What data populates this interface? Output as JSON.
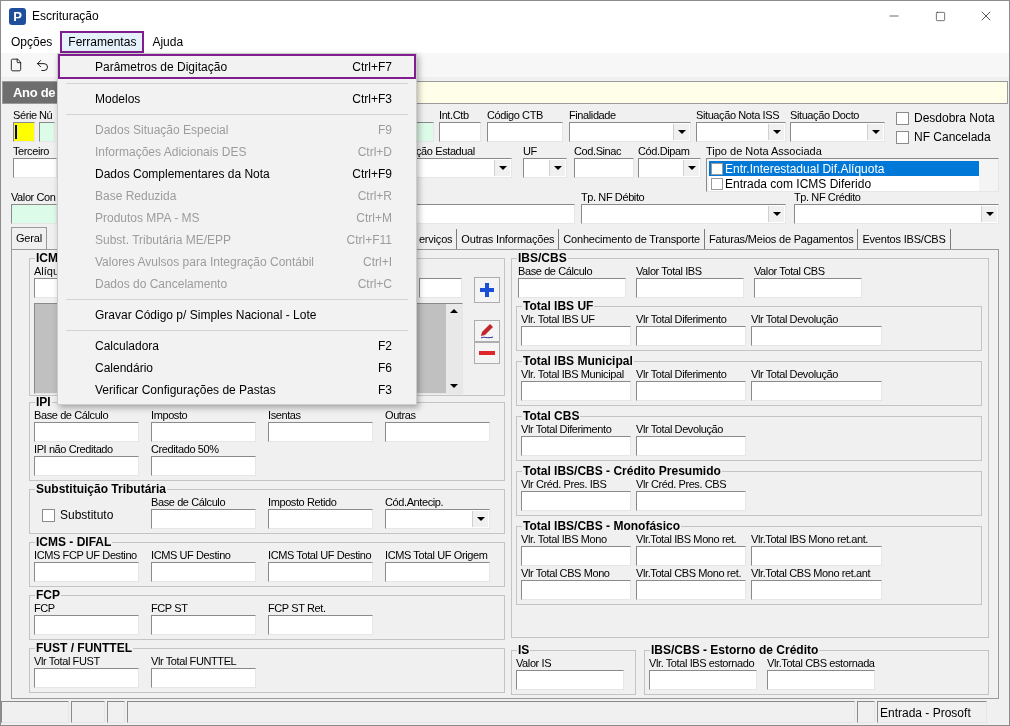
{
  "window": {
    "title": "Escrituração",
    "icon_letter": "P"
  },
  "menu_bar": [
    {
      "label": "Opções",
      "selected": false
    },
    {
      "label": "Ferramentas",
      "selected": true
    },
    {
      "label": "Ajuda",
      "selected": false
    }
  ],
  "menu": [
    {
      "kind": "item",
      "label": "Parâmetros de Digitação",
      "shortcut": "Ctrl+F7",
      "disabled": false,
      "selected": true
    },
    {
      "kind": "separator"
    },
    {
      "kind": "item",
      "label": "Modelos",
      "shortcut": "Ctrl+F3",
      "disabled": false,
      "selected": false
    },
    {
      "kind": "separator"
    },
    {
      "kind": "item",
      "label": "Dados Situação Especial",
      "shortcut": "F9",
      "disabled": true,
      "selected": false
    },
    {
      "kind": "item",
      "label": "Informações Adicionais DES",
      "shortcut": "Ctrl+D",
      "disabled": true,
      "selected": false
    },
    {
      "kind": "item",
      "label": "Dados Complementares da Nota",
      "shortcut": "Ctrl+F9",
      "disabled": false,
      "selected": false
    },
    {
      "kind": "item",
      "label": "Base Reduzida",
      "shortcut": "Ctrl+R",
      "disabled": true,
      "selected": false
    },
    {
      "kind": "item",
      "label": "Produtos MPA - MS",
      "shortcut": "Ctrl+M",
      "disabled": true,
      "selected": false
    },
    {
      "kind": "item",
      "label": "Subst. Tributária ME/EPP",
      "shortcut": "Ctrl+F11",
      "disabled": true,
      "selected": false
    },
    {
      "kind": "item",
      "label": "Valores Avulsos para Integração Contábil",
      "shortcut": "Ctrl+I",
      "disabled": true,
      "selected": false
    },
    {
      "kind": "item",
      "label": "Dados do Cancelamento",
      "shortcut": "Ctrl+C",
      "disabled": true,
      "selected": false
    },
    {
      "kind": "separator"
    },
    {
      "kind": "item",
      "label": "Gravar Código p/ Simples Nacional - Lote",
      "disabled": false,
      "selected": false
    },
    {
      "kind": "separator"
    },
    {
      "kind": "item",
      "label": "Calculadora",
      "shortcut": "F2",
      "disabled": false,
      "selected": false
    },
    {
      "kind": "item",
      "label": "Calendário",
      "shortcut": "F6",
      "disabled": false,
      "selected": false
    },
    {
      "kind": "item",
      "label": "Verificar Configurações de Pastas",
      "shortcut": "F3",
      "disabled": false,
      "selected": false
    }
  ],
  "band": {
    "title": "Ano de"
  },
  "header_row_1": [
    {
      "label": "Série",
      "kind": "focused"
    },
    {
      "label": "Nú",
      "kind": "key"
    },
    {
      "kind": "key"
    },
    {
      "label": "Int.Ctb",
      "kind": "text"
    },
    {
      "label": "Código CTB",
      "kind": "text"
    },
    {
      "label": "Finalidade",
      "kind": "combo"
    },
    {
      "label": "Situação Nota ISS",
      "kind": "combo"
    },
    {
      "label": "Situação Docto",
      "kind": "combo"
    }
  ],
  "header_checks": [
    {
      "label": "Desdobra Nota",
      "checked": false
    },
    {
      "label": "NF Cancelada",
      "checked": false
    }
  ],
  "header_row_2": [
    {
      "label": "Terceiro",
      "kind": "text"
    },
    {
      "label": "ção Estadual",
      "kind": "combo"
    },
    {
      "label": "UF",
      "kind": "combo"
    },
    {
      "label": "Cod.Sinac",
      "kind": "text"
    },
    {
      "label": "Cód.Dipam",
      "kind": "combo"
    }
  ],
  "nota_associada": {
    "label": "Tipo de Nota Associada",
    "items": [
      {
        "label": "Entr.Interestadual Dif.Alíquota",
        "checked": false,
        "selected": true
      },
      {
        "label": "Entrada com ICMS Diferido",
        "checked": false,
        "selected": false
      }
    ]
  },
  "header_row_3": [
    {
      "label": "Valor Con",
      "kind": "key"
    },
    {
      "kind": "text"
    },
    {
      "label": "Tp. NF Débito",
      "kind": "combo"
    },
    {
      "label": "Tp. NF Crédito",
      "kind": "combo"
    }
  ],
  "tabs": [
    {
      "label": "Geral",
      "selected": true
    },
    {
      "label": "erviços",
      "selected": false
    },
    {
      "label": "Outras Informações",
      "selected": false
    },
    {
      "label": "Conhecimento de Transporte",
      "selected": false
    },
    {
      "label": "Faturas/Meios de Pagamentos",
      "selected": false
    },
    {
      "label": "Eventos IBS/CBS",
      "selected": false
    }
  ],
  "icms": {
    "title": "ICM",
    "label": "Alíqu"
  },
  "ipi": {
    "title": "IPI",
    "rows": [
      [
        {
          "label": "Base de Cálculo",
          "kind": "text"
        },
        {
          "label": "Imposto",
          "kind": "text"
        },
        {
          "label": "Isentas",
          "kind": "text"
        },
        {
          "label": "Outras",
          "kind": "text"
        }
      ],
      [
        {
          "label": "IPI não Creditado",
          "kind": "text"
        },
        {
          "label": "Creditado 50%",
          "kind": "text"
        }
      ]
    ]
  },
  "st": {
    "title": "Substituição Tributária",
    "checkbox": {
      "label": "Substituto",
      "checked": false
    },
    "fields": [
      {
        "label": "Base de Cálculo",
        "kind": "text"
      },
      {
        "label": "Imposto Retido",
        "kind": "text"
      },
      {
        "label": "Cód.Antecip.",
        "kind": "combo"
      }
    ]
  },
  "left_groups": [
    {
      "title": "ICMS - DIFAL",
      "rows": [
        [
          {
            "label": "ICMS FCP UF Destino",
            "kind": "text"
          },
          {
            "label": "ICMS UF Destino",
            "kind": "text"
          },
          {
            "label": "ICMS Total UF Destino",
            "kind": "text"
          },
          {
            "label": "ICMS Total UF Origem",
            "kind": "text"
          }
        ]
      ]
    },
    {
      "title": "FCP",
      "rows": [
        [
          {
            "label": "FCP",
            "kind": "text"
          },
          {
            "label": "FCP ST",
            "kind": "text"
          },
          {
            "label": "FCP ST Ret.",
            "kind": "text"
          }
        ]
      ]
    },
    {
      "title": "FUST / FUNTTEL",
      "rows": [
        [
          {
            "label": "Vlr Total FUST",
            "kind": "text"
          },
          {
            "label": "Vlr Total FUNTTEL",
            "kind": "text"
          }
        ]
      ]
    }
  ],
  "ibs_cbs": {
    "title": "IBS/CBS",
    "fields": [
      {
        "label": "Base de Cálculo",
        "kind": "text"
      },
      {
        "label": "Valor Total IBS",
        "kind": "text"
      },
      {
        "label": "Valor Total CBS",
        "kind": "text"
      }
    ],
    "subgroups": [
      {
        "title": "Total IBS UF",
        "rows": [
          [
            {
              "label": "Vlr. Total IBS UF",
              "kind": "text"
            },
            {
              "label": "Vlr Total Diferimento",
              "kind": "text"
            },
            {
              "label": "Vlr Total Devolução",
              "kind": "text"
            }
          ]
        ]
      },
      {
        "title": "Total IBS Municipal",
        "rows": [
          [
            {
              "label": "Vlr. Total IBS Municipal",
              "kind": "text"
            },
            {
              "label": "Vlr Total Diferimento",
              "kind": "text"
            },
            {
              "label": "Vlr Total Devolução",
              "kind": "text"
            }
          ]
        ]
      },
      {
        "title": "Total CBS",
        "rows": [
          [
            {
              "label": "Vlr Total Diferimento",
              "kind": "text"
            },
            {
              "label": "Vlr Total Devolução",
              "kind": "text"
            }
          ]
        ]
      },
      {
        "title": "Total IBS/CBS - Crédito Presumido",
        "rows": [
          [
            {
              "label": "Vlr Créd. Pres. IBS",
              "kind": "text"
            },
            {
              "label": "Vlr Créd. Pres. CBS",
              "kind": "text"
            }
          ]
        ]
      },
      {
        "title": "Total IBS/CBS - Monofásico",
        "rows": [
          [
            {
              "label": "Vlr. Total IBS Mono",
              "kind": "text"
            },
            {
              "label": "Vlr.Total IBS Mono ret.",
              "kind": "text"
            },
            {
              "label": "Vlr.Total IBS Mono ret.ant.",
              "kind": "text"
            }
          ],
          [
            {
              "label": "Vlr Total CBS Mono",
              "kind": "text"
            },
            {
              "label": "Vlr.Total CBS Mono ret.",
              "kind": "text"
            },
            {
              "label": "Vlr.Total CBS Mono ret.ant",
              "kind": "text"
            }
          ]
        ]
      }
    ]
  },
  "bottom_groups": [
    {
      "title": "IS",
      "rows": [
        [
          {
            "label": "Valor IS",
            "kind": "text"
          }
        ]
      ]
    },
    {
      "title": "IBS/CBS - Estorno de Crédito",
      "rows": [
        [
          {
            "label": "Vlr. Total IBS estornado",
            "kind": "text"
          },
          {
            "label": "Vlr.Total CBS estornada",
            "kind": "text"
          }
        ]
      ]
    }
  ],
  "status_bar": {
    "text": "Entrada - Prosoft"
  }
}
